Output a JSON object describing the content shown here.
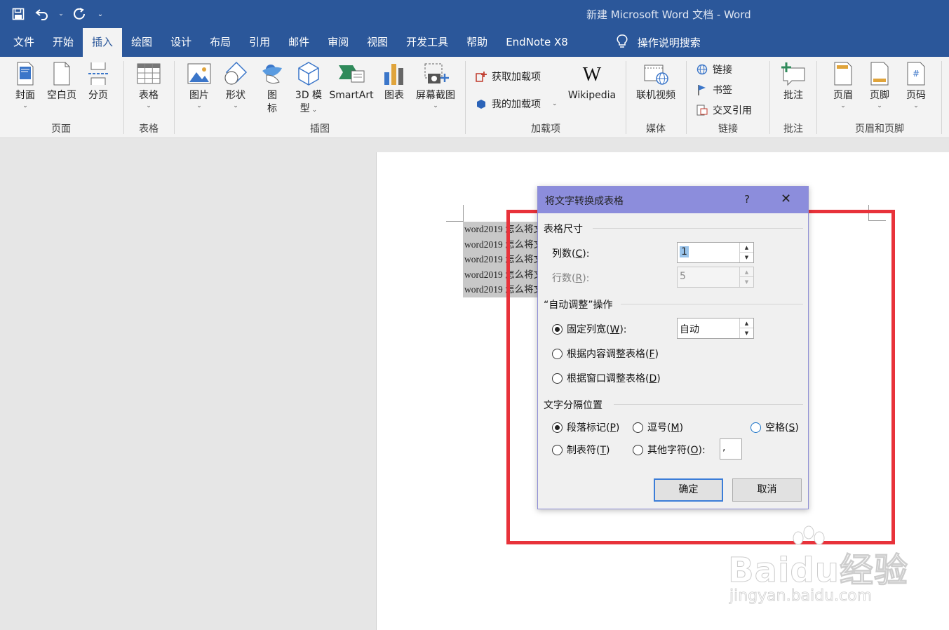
{
  "window": {
    "title": "新建 Microsoft Word 文档 - Word"
  },
  "menu": {
    "tabs": [
      "文件",
      "开始",
      "插入",
      "绘图",
      "设计",
      "布局",
      "引用",
      "邮件",
      "审阅",
      "视图",
      "开发工具",
      "帮助",
      "EndNote X8"
    ],
    "active_tab": "插入",
    "tell_me": "操作说明搜索"
  },
  "ribbon": {
    "pages": {
      "label": "页面",
      "cover": "封面",
      "blank": "空白页",
      "break": "分页"
    },
    "tables": {
      "label": "表格",
      "table": "表格"
    },
    "illustrations": {
      "label": "插图",
      "picture": "图片",
      "shapes": "形状",
      "icons_1": "图",
      "icons_2": "标",
      "model_1": "3D 模",
      "model_2": "型",
      "smartart": "SmartArt",
      "chart": "图表",
      "screenshot": "屏幕截图"
    },
    "addins": {
      "label": "加载项",
      "get": "获取加载项",
      "my": "我的加载项",
      "wikipedia": "Wikipedia",
      "w_glyph": "W"
    },
    "media": {
      "label": "媒体",
      "video": "联机视频"
    },
    "links": {
      "label": "链接",
      "link": "链接",
      "bookmark": "书签",
      "crossref": "交叉引用"
    },
    "comments": {
      "label": "批注",
      "comment": "批注"
    },
    "headerfooter": {
      "label": "页眉和页脚",
      "header": "页眉",
      "footer": "页脚",
      "pagenum": "页码"
    }
  },
  "document": {
    "lines": [
      "word2019 怎么将文",
      "word2019 怎么将文",
      "word2019 怎么将文",
      "word2019 怎么将文",
      "word2019 怎么将文"
    ]
  },
  "dialog": {
    "title": "将文字转换成表格",
    "help": "?",
    "close": "✕",
    "size": {
      "title": "表格尺寸",
      "cols_label": "列数(",
      "cols_key": "C",
      "cols_end": "):",
      "cols_value": "1",
      "rows_label": "行数(",
      "rows_key": "R",
      "rows_end": "):",
      "rows_value": "5"
    },
    "autofit": {
      "title": "“自动调整”操作",
      "fixed_label": "固定列宽(",
      "fixed_key": "W",
      "fixed_end": "):",
      "fixed_value": "自动",
      "content_label": "根据内容调整表格(",
      "content_key": "F",
      "content_end": ")",
      "window_label": "根据窗口调整表格(",
      "window_key": "D",
      "window_end": ")"
    },
    "separator": {
      "title": "文字分隔位置",
      "para_label": "段落标记(",
      "para_key": "P",
      "para_end": ")",
      "comma_label": "逗号(",
      "comma_key": "M",
      "comma_end": ")",
      "space_label": "空格(",
      "space_key": "S",
      "space_end": ")",
      "tab_label": "制表符(",
      "tab_key": "T",
      "tab_end": ")",
      "other_label": "其他字符(",
      "other_key": "O",
      "other_end": "):",
      "other_value": ","
    },
    "ok": "确定",
    "cancel": "取消"
  },
  "watermark": {
    "brand": "Baidu经验",
    "url": "jingyan.baidu.com"
  },
  "colors": {
    "title_bar": "#2b579a",
    "dialog_title": "#8c8ddc",
    "highlight_box": "#e8323a"
  }
}
